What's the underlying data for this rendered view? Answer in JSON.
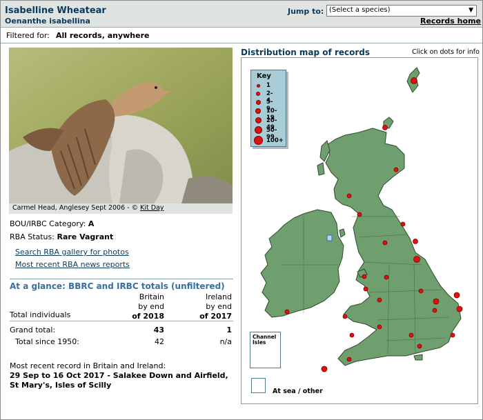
{
  "header": {
    "species_name": "Isabelline Wheatear",
    "species_latin": "Oenanthe isabellina",
    "jump_label": "Jump to:",
    "jump_select_value": "(Select a species)",
    "records_home": "Records home"
  },
  "filter": {
    "label": "Filtered for:",
    "value": "All records, anywhere"
  },
  "photo": {
    "caption_prefix": "Carmel Head, Anglesey Sept 2006 - ©",
    "caption_author": "Kit Day"
  },
  "status": {
    "category_label": "BOU/IRBC Category:",
    "category_value": "A",
    "rba_label": "RBA Status:",
    "rba_value": "Rare Vagrant",
    "link_gallery": "Search RBA gallery for photos",
    "link_news": "Most recent RBA news reports"
  },
  "glance": {
    "title": "At a glance: BBRC and IRBC totals (unfiltered)",
    "britain_head": [
      "Britain",
      "by end",
      "of 2018"
    ],
    "ireland_head": [
      "Ireland",
      "by end",
      "of 2017"
    ],
    "row_label_individuals": "Total individuals",
    "grand_total_label": "Grand total:",
    "grand_total_britain": "43",
    "grand_total_ireland": "1",
    "since_1950_label": "Total since 1950:",
    "since_1950_britain": "42",
    "since_1950_ireland": "n/a"
  },
  "recent": {
    "label": "Most recent record in Britain and Ireland:",
    "value": "29 Sep to 16 Oct 2017 - Salakee Down and Airfield, St Mary's, Isles of Scilly"
  },
  "map": {
    "title": "Distribution map of records",
    "hint": "Click on dots for info",
    "key_title": "Key",
    "key_items": [
      "1",
      "2-4",
      "5-9",
      "10-19",
      "20-49",
      "50-99",
      "100+"
    ],
    "channel_label": "Channel Isles",
    "sea_label": "At sea / other",
    "land_color": "#6f9f6f",
    "dot_color": "#e01010"
  }
}
